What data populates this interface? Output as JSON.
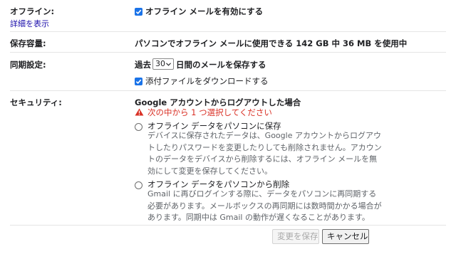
{
  "offline": {
    "label": "オフライン:",
    "details_link": "詳細を表示",
    "enable_checkbox_label": "オフライン メールを有効にする",
    "enable_checked": true
  },
  "storage": {
    "label": "保存容量:",
    "text": "パソコンでオフライン メールに使用できる 142 GB 中 36 MB を使用中"
  },
  "sync": {
    "label": "同期設定:",
    "prefix": "過去",
    "days_value": "30",
    "suffix": "日間のメールを保存する",
    "attachments_label": "添付ファイルをダウンロードする",
    "attachments_checked": true
  },
  "security": {
    "label": "セキュリティ:",
    "heading": "Google アカウントからログアウトした場合",
    "error": "次の中から 1 つ選択してください",
    "options": [
      {
        "title": "オフライン データをパソコンに保存",
        "description": "デバイスに保存されたデータは、Google アカウントからログアウトしたりパスワードを変更したりしても削除されません。アカウントのデータをデバイスから削除するには、オフライン メールを無効にして変更を保存してください。",
        "selected": false
      },
      {
        "title": "オフライン データをパソコンから削除",
        "description": "Gmail に再びログインする際に、データをパソコンに再同期する必要があります。メールボックスの再同期には数時間かかる場合があります。同期中は Gmail の動作が遅くなることがあります。",
        "selected": false
      }
    ]
  },
  "buttons": {
    "save": "変更を保存",
    "cancel": "キャンセル"
  },
  "colors": {
    "checkbox": "#1a73e8",
    "link": "#1a0dab",
    "error": "#d93025",
    "text": "#202124",
    "muted": "#5f6368"
  },
  "icons": {
    "checkbox": "check-icon",
    "warning": "warning-icon",
    "dropdown": "chevron-down-icon"
  }
}
